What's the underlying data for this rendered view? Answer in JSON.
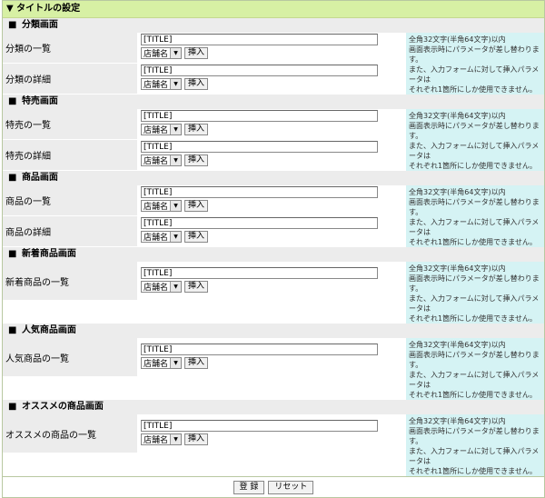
{
  "header": {
    "title": "▼ タイトルの設定"
  },
  "sections": [
    {
      "title": "分類画面",
      "rows": [
        {
          "label": "分類の一覧",
          "value": "[TITLE]",
          "select": "店舗名",
          "insert": "挿入"
        },
        {
          "label": "分類の詳細",
          "value": "[TITLE]",
          "select": "店舗名",
          "insert": "挿入"
        }
      ],
      "note": [
        "全角32文字(半角64文字)以内",
        "画面表示時にパラメータが差し替わります。",
        "また、入力フォームに対して挿入パラメータは",
        "それぞれ1箇所にしか使用できません。"
      ]
    },
    {
      "title": "特売画面",
      "rows": [
        {
          "label": "特売の一覧",
          "value": "[TITLE]",
          "select": "店舗名",
          "insert": "挿入"
        },
        {
          "label": "特売の詳細",
          "value": "[TITLE]",
          "select": "店舗名",
          "insert": "挿入"
        }
      ],
      "note": [
        "全角32文字(半角64文字)以内",
        "画面表示時にパラメータが差し替わります。",
        "また、入力フォームに対して挿入パラメータは",
        "それぞれ1箇所にしか使用できません。"
      ]
    },
    {
      "title": "商品画面",
      "rows": [
        {
          "label": "商品の一覧",
          "value": "[TITLE]",
          "select": "店舗名",
          "insert": "挿入"
        },
        {
          "label": "商品の詳細",
          "value": "[TITLE]",
          "select": "店舗名",
          "insert": "挿入"
        }
      ],
      "note": [
        "全角32文字(半角64文字)以内",
        "画面表示時にパラメータが差し替わります。",
        "また、入力フォームに対して挿入パラメータは",
        "それぞれ1箇所にしか使用できません。"
      ]
    },
    {
      "title": "新着商品画面",
      "rows": [
        {
          "label": "新着商品の一覧",
          "value": "[TITLE]",
          "select": "店舗名",
          "insert": "挿入"
        }
      ],
      "note": [
        "全角32文字(半角64文字)以内",
        "画面表示時にパラメータが差し替わります。",
        "また、入力フォームに対して挿入パラメータは",
        "それぞれ1箇所にしか使用できません。"
      ]
    },
    {
      "title": "人気商品画面",
      "rows": [
        {
          "label": "人気商品の一覧",
          "value": "[TITLE]",
          "select": "店舗名",
          "insert": "挿入"
        }
      ],
      "note": [
        "全角32文字(半角64文字)以内",
        "画面表示時にパラメータが差し替わります。",
        "また、入力フォームに対して挿入パラメータは",
        "それぞれ1箇所にしか使用できません。"
      ]
    },
    {
      "title": "オススメの商品画面",
      "rows": [
        {
          "label": "オススメの商品の一覧",
          "value": "[TITLE]",
          "select": "店舗名",
          "insert": "挿入"
        }
      ],
      "note": [
        "全角32文字(半角64文字)以内",
        "画面表示時にパラメータが差し替わります。",
        "また、入力フォームに対して挿入パラメータは",
        "それぞれ1箇所にしか使用できません。"
      ]
    }
  ],
  "footer": {
    "submit": "登 録",
    "reset": "リセット"
  },
  "section_marker": "■",
  "colors": {
    "title_bar": "#d7f0a4",
    "label_bg": "#ececec",
    "note_bg": "#d5f3f4"
  }
}
